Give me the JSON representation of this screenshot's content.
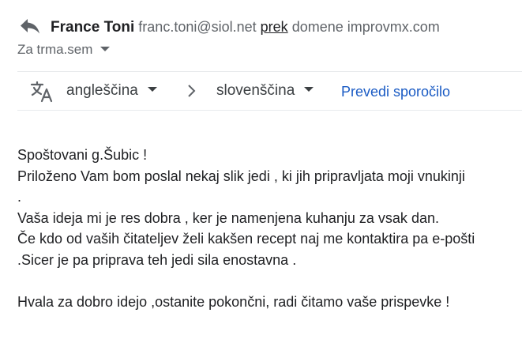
{
  "header": {
    "sender_name": "France Toni",
    "sender_email": "franc.toni@siol.net",
    "via_link": "prek",
    "via_domain": "domene improvmx.com",
    "recipient": "Za trma.sem"
  },
  "icons": {
    "reply": "reply-icon",
    "translate": "translate-icon",
    "arrow": "chevron-right-icon",
    "dropdown": "caret-down-icon"
  },
  "translate_bar": {
    "source_language": "angleščina",
    "target_language": "slovenščina",
    "translate_label": "Prevedi sporočilo"
  },
  "message": {
    "lines": [
      "Spoštovani g.Šubic !",
      "Priloženo Vam bom poslal nekaj slik jedi , ki jih pripravljata moji vnukinji",
      ".",
      "Vaša ideja mi je res dobra , ker je namenjena kuhanju za vsak dan.",
      "Če kdo od vaših čitateljev želi kakšen recept naj me kontaktira pa e-pošti",
      ".Sicer je pa priprava teh jedi sila enostavna .",
      "",
      "Hvala za dobro idejo ,ostanite pokončni, radi čitamo vaše prispevke !"
    ]
  },
  "colors": {
    "link_blue": "#1a5bc4",
    "text": "#202124",
    "muted": "#5f6368",
    "divider": "#e8eaed"
  }
}
